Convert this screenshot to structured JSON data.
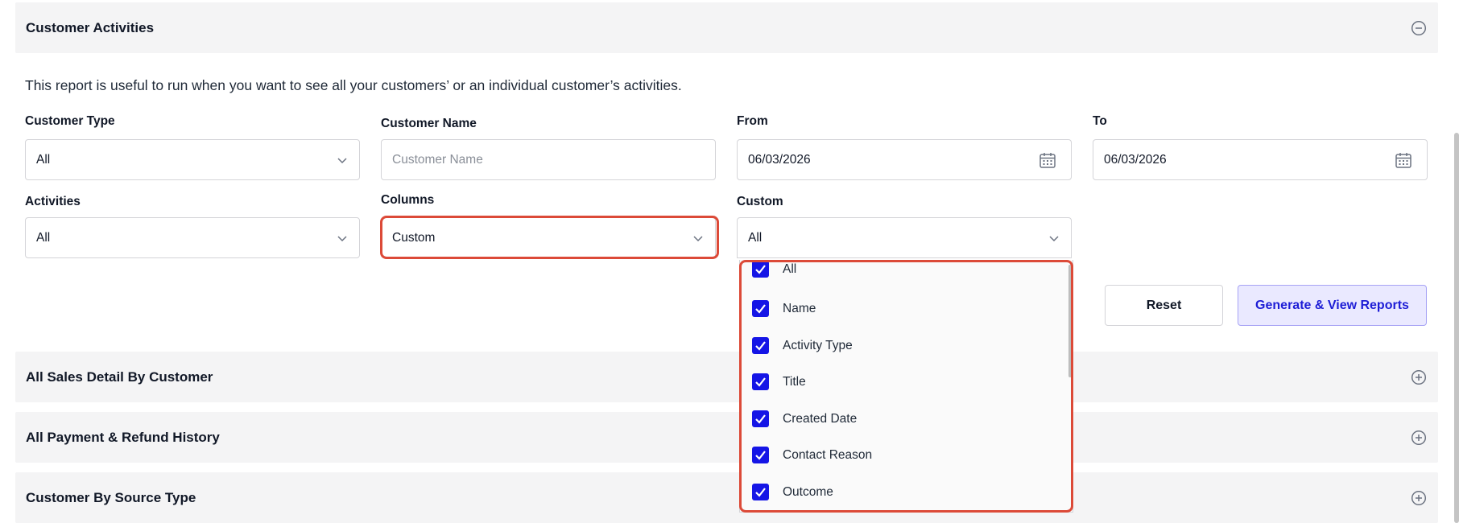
{
  "sections": {
    "customer_activities": {
      "title": "Customer Activities"
    },
    "sales_detail": {
      "title": "All Sales Detail By Customer"
    },
    "payment_refund": {
      "title": "All Payment & Refund History"
    },
    "source_type": {
      "title": "Customer By Source Type"
    }
  },
  "report": {
    "description": "This report is useful to run when you want to see all your customers’ or an individual customer’s activities.",
    "customer_type": {
      "label": "Customer Type",
      "value": "All"
    },
    "customer_name": {
      "label": "Customer Name",
      "placeholder": "Customer Name"
    },
    "from": {
      "label": "From",
      "value": "06/03/2026"
    },
    "to": {
      "label": "To",
      "value": "06/03/2026"
    },
    "activities": {
      "label": "Activities",
      "value": "All"
    },
    "columns": {
      "label": "Columns",
      "value": "Custom"
    },
    "custom": {
      "label": "Custom",
      "value": "All",
      "options": [
        {
          "label": "All",
          "checked": true
        },
        {
          "label": "Name",
          "checked": true
        },
        {
          "label": "Activity Type",
          "checked": true
        },
        {
          "label": "Title",
          "checked": true
        },
        {
          "label": "Created Date",
          "checked": true
        },
        {
          "label": "Contact Reason",
          "checked": true
        },
        {
          "label": "Outcome",
          "checked": true
        }
      ]
    },
    "buttons": {
      "reset": "Reset",
      "generate": "Generate & View Reports"
    }
  },
  "icons": {
    "collapse": "minus-circle-icon",
    "expand": "plus-circle-icon",
    "calendar": "calendar-icon",
    "chevron": "chevron-down-icon",
    "checkbox": "checkbox-checked-icon"
  },
  "colors": {
    "accent": "#1515e6",
    "highlight": "#dc4a38",
    "primary_button_bg": "#eae9ff",
    "primary_button_text": "#1d1dd6",
    "section_bg": "#f4f4f5"
  }
}
